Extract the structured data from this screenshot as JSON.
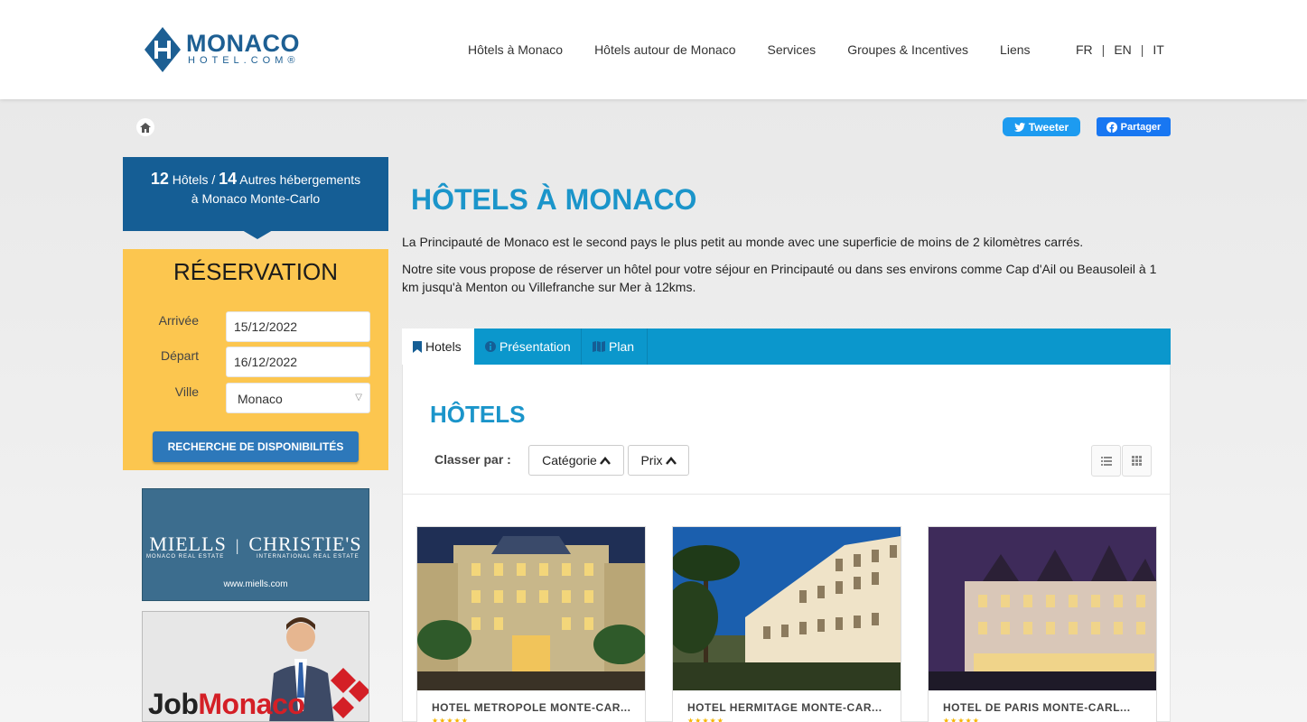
{
  "header": {
    "logo_name": "MONACO",
    "logo_sub": "HOTEL.COM®",
    "nav": [
      "Hôtels à Monaco",
      "Hôtels autour de Monaco",
      "Services",
      "Groupes & Incentives",
      "Liens"
    ],
    "languages": [
      "FR",
      "EN",
      "IT"
    ]
  },
  "social": {
    "tweet": "Tweeter",
    "share": "Partager"
  },
  "sidebar": {
    "hotels_count": "12",
    "hotels_label": "Hôtels /",
    "others_count": "14",
    "others_label": "Autres hébergements",
    "location": "à Monaco Monte-Carlo",
    "reservation": {
      "title": "RÉSERVATION",
      "arrival_label": "Arrivée",
      "arrival_value": "15/12/2022",
      "departure_label": "Départ",
      "departure_value": "16/12/2022",
      "city_label": "Ville",
      "city_value": "Monaco",
      "search_button": "RECHERCHE DE DISPONIBILITÉS"
    },
    "ads": {
      "miells_left": "MIELLS",
      "miells_right": "CHRISTIE'S",
      "miells_sub_left": "MONACO REAL ESTATE",
      "miells_sub_right": "INTERNATIONAL REAL ESTATE",
      "miells_url": "www.miells.com",
      "job_part1": "Job",
      "job_part2": "Monaco"
    }
  },
  "main": {
    "title": "HÔTELS À MONACO",
    "intro1": "La Principauté de Monaco est le second pays le plus petit au monde avec une superficie de moins de 2 kilomètres carrés.",
    "intro2": "Notre site vous propose de réserver un hôtel pour votre séjour en Principauté ou dans ses environs comme Cap d'Ail ou Beausoleil à 1 km jusqu'à Menton ou Villefranche sur Mer à 12kms.",
    "tabs": [
      "Hotels",
      "Présentation",
      "Plan"
    ],
    "panel_title": "HÔTELS",
    "sort_label": "Classer par :",
    "sort_category": "Catégorie",
    "sort_price": "Prix",
    "hotels": [
      {
        "name": "HOTEL METROPOLE MONTE-CAR...",
        "stars": "★★★★★"
      },
      {
        "name": "HOTEL HERMITAGE MONTE-CAR...",
        "stars": "★★★★★"
      },
      {
        "name": "HOTEL DE PARIS MONTE-CARL...",
        "stars": "★★★★★"
      }
    ]
  },
  "colors": {
    "brand_blue": "#155e95",
    "accent_cyan": "#0b97cc",
    "reservation_yellow": "#fcc64f",
    "button_blue": "#2d78ba"
  }
}
